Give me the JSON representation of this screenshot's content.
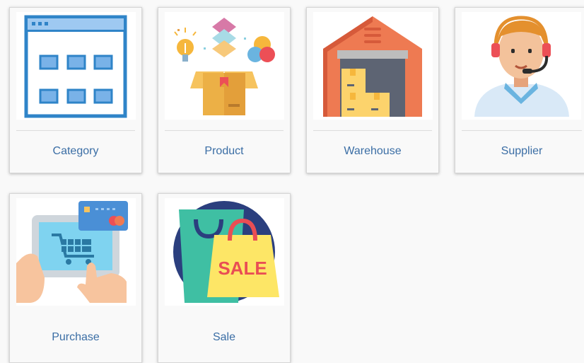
{
  "cards": [
    {
      "label": "Category",
      "icon": "category-window-icon"
    },
    {
      "label": "Product",
      "icon": "product-box-icon"
    },
    {
      "label": "Warehouse",
      "icon": "warehouse-icon"
    },
    {
      "label": "Supplier",
      "icon": "supplier-agent-icon"
    },
    {
      "label": "Purchase",
      "icon": "purchase-tablet-cart-icon"
    },
    {
      "label": "Sale",
      "icon": "sale-bags-icon"
    }
  ],
  "colors": {
    "label": "#3b6ea5",
    "category_blue": "#2f84c8",
    "warehouse_orange": "#ee7a52",
    "sale_yellow": "#fde666",
    "sale_red": "#e94e54"
  }
}
